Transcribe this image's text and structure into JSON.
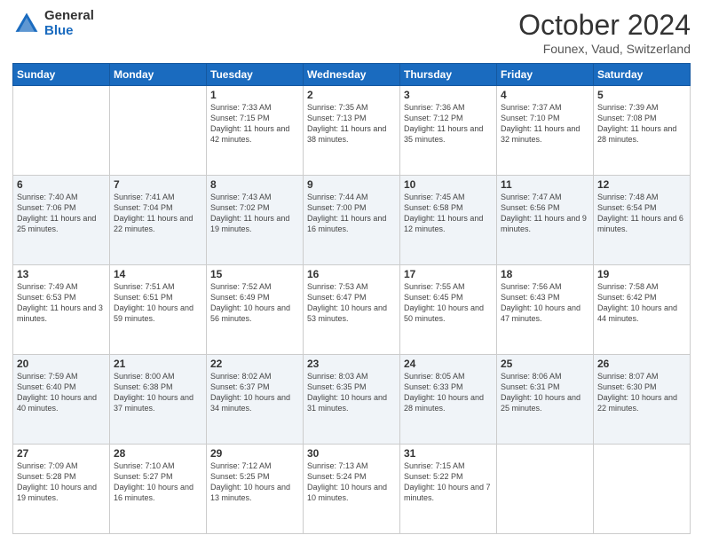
{
  "header": {
    "logo_general": "General",
    "logo_blue": "Blue",
    "month_title": "October 2024",
    "location": "Founex, Vaud, Switzerland"
  },
  "days_of_week": [
    "Sunday",
    "Monday",
    "Tuesday",
    "Wednesday",
    "Thursday",
    "Friday",
    "Saturday"
  ],
  "weeks": [
    [
      {
        "day": "",
        "info": ""
      },
      {
        "day": "",
        "info": ""
      },
      {
        "day": "1",
        "info": "Sunrise: 7:33 AM\nSunset: 7:15 PM\nDaylight: 11 hours and 42 minutes."
      },
      {
        "day": "2",
        "info": "Sunrise: 7:35 AM\nSunset: 7:13 PM\nDaylight: 11 hours and 38 minutes."
      },
      {
        "day": "3",
        "info": "Sunrise: 7:36 AM\nSunset: 7:12 PM\nDaylight: 11 hours and 35 minutes."
      },
      {
        "day": "4",
        "info": "Sunrise: 7:37 AM\nSunset: 7:10 PM\nDaylight: 11 hours and 32 minutes."
      },
      {
        "day": "5",
        "info": "Sunrise: 7:39 AM\nSunset: 7:08 PM\nDaylight: 11 hours and 28 minutes."
      }
    ],
    [
      {
        "day": "6",
        "info": "Sunrise: 7:40 AM\nSunset: 7:06 PM\nDaylight: 11 hours and 25 minutes."
      },
      {
        "day": "7",
        "info": "Sunrise: 7:41 AM\nSunset: 7:04 PM\nDaylight: 11 hours and 22 minutes."
      },
      {
        "day": "8",
        "info": "Sunrise: 7:43 AM\nSunset: 7:02 PM\nDaylight: 11 hours and 19 minutes."
      },
      {
        "day": "9",
        "info": "Sunrise: 7:44 AM\nSunset: 7:00 PM\nDaylight: 11 hours and 16 minutes."
      },
      {
        "day": "10",
        "info": "Sunrise: 7:45 AM\nSunset: 6:58 PM\nDaylight: 11 hours and 12 minutes."
      },
      {
        "day": "11",
        "info": "Sunrise: 7:47 AM\nSunset: 6:56 PM\nDaylight: 11 hours and 9 minutes."
      },
      {
        "day": "12",
        "info": "Sunrise: 7:48 AM\nSunset: 6:54 PM\nDaylight: 11 hours and 6 minutes."
      }
    ],
    [
      {
        "day": "13",
        "info": "Sunrise: 7:49 AM\nSunset: 6:53 PM\nDaylight: 11 hours and 3 minutes."
      },
      {
        "day": "14",
        "info": "Sunrise: 7:51 AM\nSunset: 6:51 PM\nDaylight: 10 hours and 59 minutes."
      },
      {
        "day": "15",
        "info": "Sunrise: 7:52 AM\nSunset: 6:49 PM\nDaylight: 10 hours and 56 minutes."
      },
      {
        "day": "16",
        "info": "Sunrise: 7:53 AM\nSunset: 6:47 PM\nDaylight: 10 hours and 53 minutes."
      },
      {
        "day": "17",
        "info": "Sunrise: 7:55 AM\nSunset: 6:45 PM\nDaylight: 10 hours and 50 minutes."
      },
      {
        "day": "18",
        "info": "Sunrise: 7:56 AM\nSunset: 6:43 PM\nDaylight: 10 hours and 47 minutes."
      },
      {
        "day": "19",
        "info": "Sunrise: 7:58 AM\nSunset: 6:42 PM\nDaylight: 10 hours and 44 minutes."
      }
    ],
    [
      {
        "day": "20",
        "info": "Sunrise: 7:59 AM\nSunset: 6:40 PM\nDaylight: 10 hours and 40 minutes."
      },
      {
        "day": "21",
        "info": "Sunrise: 8:00 AM\nSunset: 6:38 PM\nDaylight: 10 hours and 37 minutes."
      },
      {
        "day": "22",
        "info": "Sunrise: 8:02 AM\nSunset: 6:37 PM\nDaylight: 10 hours and 34 minutes."
      },
      {
        "day": "23",
        "info": "Sunrise: 8:03 AM\nSunset: 6:35 PM\nDaylight: 10 hours and 31 minutes."
      },
      {
        "day": "24",
        "info": "Sunrise: 8:05 AM\nSunset: 6:33 PM\nDaylight: 10 hours and 28 minutes."
      },
      {
        "day": "25",
        "info": "Sunrise: 8:06 AM\nSunset: 6:31 PM\nDaylight: 10 hours and 25 minutes."
      },
      {
        "day": "26",
        "info": "Sunrise: 8:07 AM\nSunset: 6:30 PM\nDaylight: 10 hours and 22 minutes."
      }
    ],
    [
      {
        "day": "27",
        "info": "Sunrise: 7:09 AM\nSunset: 5:28 PM\nDaylight: 10 hours and 19 minutes."
      },
      {
        "day": "28",
        "info": "Sunrise: 7:10 AM\nSunset: 5:27 PM\nDaylight: 10 hours and 16 minutes."
      },
      {
        "day": "29",
        "info": "Sunrise: 7:12 AM\nSunset: 5:25 PM\nDaylight: 10 hours and 13 minutes."
      },
      {
        "day": "30",
        "info": "Sunrise: 7:13 AM\nSunset: 5:24 PM\nDaylight: 10 hours and 10 minutes."
      },
      {
        "day": "31",
        "info": "Sunrise: 7:15 AM\nSunset: 5:22 PM\nDaylight: 10 hours and 7 minutes."
      },
      {
        "day": "",
        "info": ""
      },
      {
        "day": "",
        "info": ""
      }
    ]
  ]
}
